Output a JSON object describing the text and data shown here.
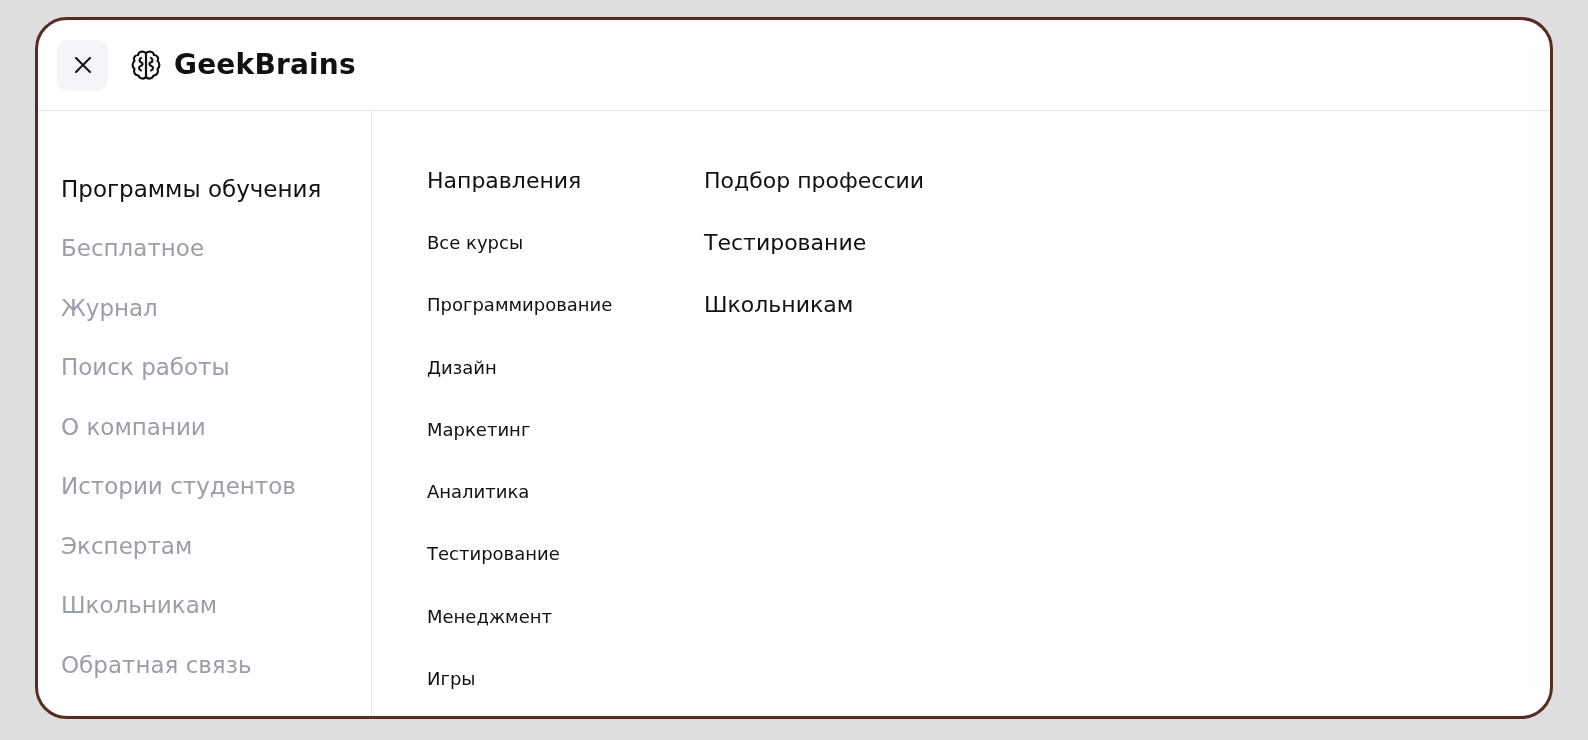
{
  "header": {
    "logo": {
      "text": "GeekBrains"
    }
  },
  "sidebar": {
    "items": [
      {
        "label": "Программы обучения",
        "selected": true
      },
      {
        "label": "Бесплатное",
        "selected": false
      },
      {
        "label": "Журнал",
        "selected": false
      },
      {
        "label": "Поиск работы",
        "selected": false
      },
      {
        "label": "О компании",
        "selected": false
      },
      {
        "label": "Истории студентов",
        "selected": false
      },
      {
        "label": "Экспертам",
        "selected": false
      },
      {
        "label": "Школьникам",
        "selected": false
      },
      {
        "label": "Обратная связь",
        "selected": false
      }
    ]
  },
  "directions": {
    "heading": "Направления",
    "links": [
      "Все курсы",
      "Программирование",
      "Дизайн",
      "Маркетинг",
      "Аналитика",
      "Тестирование",
      "Менеджмент",
      "Игры"
    ]
  },
  "quick_links": [
    "Подбор профессии",
    "Тестирование",
    "Школьникам"
  ]
}
